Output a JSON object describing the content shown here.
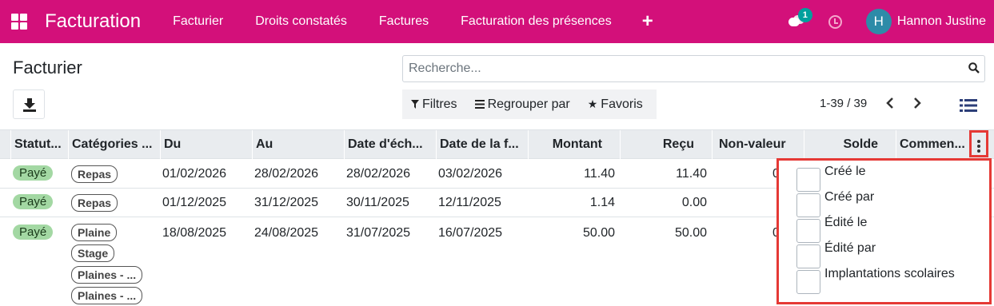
{
  "navbar": {
    "brand": "Facturation",
    "menu": [
      "Facturier",
      "Droits constatés",
      "Factures",
      "Facturation des présences"
    ],
    "plus": "+",
    "messages_count": "1",
    "user_initial": "H",
    "user_name": "Hannon Justine"
  },
  "control": {
    "title": "Facturier",
    "search_placeholder": "Recherche...",
    "filters": "Filtres",
    "group_by": "Regrouper par",
    "favorites": "Favoris",
    "pager": "1-39 / 39"
  },
  "columns": [
    "Statut...",
    "Catégories ...",
    "Du",
    "Au",
    "Date d'éch...",
    "Date de la f...",
    "Montant",
    "Reçu",
    "Non-valeur",
    "Solde",
    "Commen..."
  ],
  "rows": [
    {
      "status": "Payé",
      "tags": [
        "Repas"
      ],
      "du": "01/02/2026",
      "au": "28/02/2026",
      "echeance": "28/02/2026",
      "date_facture": "03/02/2026",
      "montant": "11.40",
      "recu": "11.40",
      "non_valeur": "0"
    },
    {
      "status": "Payé",
      "tags": [
        "Repas"
      ],
      "du": "01/12/2025",
      "au": "31/12/2025",
      "echeance": "30/11/2025",
      "date_facture": "12/11/2025",
      "montant": "1.14",
      "recu": "0.00",
      "non_valeur": ""
    },
    {
      "status": "Payé",
      "tags": [
        "Plaine",
        "Stage",
        "Plaines - ...",
        "Plaines - ..."
      ],
      "du": "18/08/2025",
      "au": "24/08/2025",
      "echeance": "31/07/2025",
      "date_facture": "16/07/2025",
      "montant": "50.00",
      "recu": "50.00",
      "non_valeur": "0"
    }
  ],
  "optional_columns": [
    "Créé le",
    "Créé par",
    "Édité le",
    "Édité par",
    "Implantations scolaires"
  ],
  "colors": {
    "primary": "#d3107a",
    "badge": "#00a09d",
    "highlight": "#e53935"
  }
}
